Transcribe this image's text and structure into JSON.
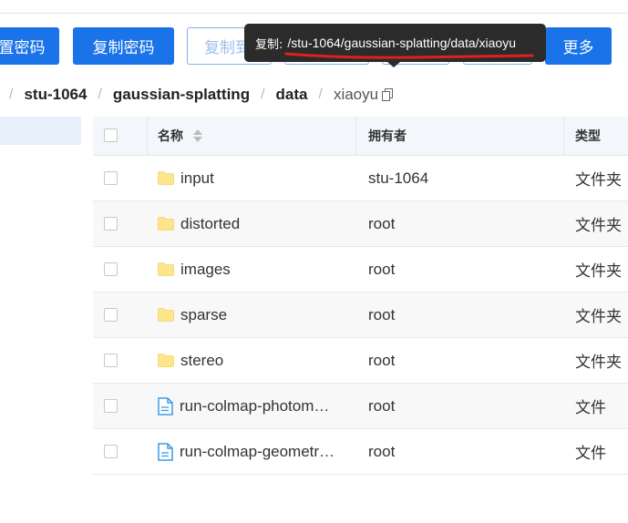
{
  "toolbar": {
    "reset_password_label": "重置密码",
    "copy_password_label": "复制密码",
    "copy_to_label": "复制到",
    "more_label": "更多"
  },
  "tooltip": {
    "label": "复制:",
    "path": "/stu-1064/gaussian-splatting/data/xiaoyu"
  },
  "breadcrumb": {
    "separator": "/",
    "segments": [
      "stu-1064",
      "gaussian-splatting",
      "data"
    ],
    "current": "xiaoyu"
  },
  "table": {
    "headers": {
      "name": "名称",
      "owner": "拥有者",
      "type": "类型"
    },
    "rows": [
      {
        "name": "input",
        "owner": "stu-1064",
        "type": "文件夹",
        "icon": "folder-icon"
      },
      {
        "name": "distorted",
        "owner": "root",
        "type": "文件夹",
        "icon": "folder-icon"
      },
      {
        "name": "images",
        "owner": "root",
        "type": "文件夹",
        "icon": "folder-icon"
      },
      {
        "name": "sparse",
        "owner": "root",
        "type": "文件夹",
        "icon": "folder-icon"
      },
      {
        "name": "stereo",
        "owner": "root",
        "type": "文件夹",
        "icon": "folder-icon"
      },
      {
        "name": "run-colmap-photom…",
        "owner": "root",
        "type": "文件",
        "icon": "file-icon"
      },
      {
        "name": "run-colmap-geometr…",
        "owner": "root",
        "type": "文件",
        "icon": "file-icon"
      }
    ]
  },
  "colors": {
    "primary": "#1a73e8",
    "tooltip_bg": "#2b2b2b",
    "annotation_red": "#e0201b",
    "folder": "#fde68a",
    "file": "#3b9be8"
  }
}
